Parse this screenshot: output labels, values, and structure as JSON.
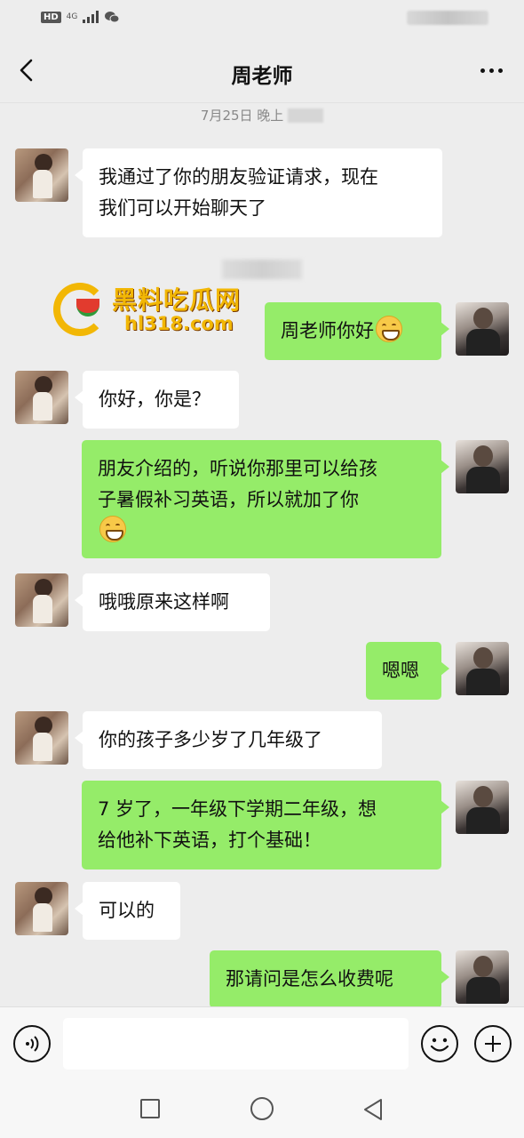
{
  "status_bar": {
    "hd": "HD",
    "network": "4G"
  },
  "header": {
    "title": "周老师",
    "back_icon": "chevron-left-icon",
    "more_icon": "more-dots-icon"
  },
  "timestamp": "7月25日 晚上",
  "watermark": {
    "title": "黑料吃瓜网",
    "subtitle": "hl318.com"
  },
  "messages": [
    {
      "side": "left",
      "text": "我通过了你的朋友验证请求，现在\n我们可以开始聊天了"
    },
    {
      "side": "right",
      "text": "周老师你好",
      "emoji": "grinning-face-emoji"
    },
    {
      "side": "left",
      "text": "你好，你是？"
    },
    {
      "side": "right",
      "text": "朋友介绍的，听说你那里可以给孩\n子暑假补习英语，所以就加了你",
      "emoji": "grinning-face-emoji"
    },
    {
      "side": "left",
      "text": "哦哦原来这样啊"
    },
    {
      "side": "right",
      "text": "嗯嗯"
    },
    {
      "side": "left",
      "text": "你的孩子多少岁了几年级了"
    },
    {
      "side": "right",
      "text": "7 岁了，一年级下学期二年级，想\n给他补下英语，打个基础！"
    },
    {
      "side": "left",
      "text": "可以的"
    },
    {
      "side": "right",
      "text": "那请问是怎么收费呢"
    }
  ],
  "input_bar": {
    "voice_icon": "voice-icon",
    "emoji_icon": "emoji-icon",
    "plus_icon": "plus-icon",
    "input_value": ""
  },
  "colors": {
    "sent_bubble": "#95ec69",
    "received_bubble": "#ffffff",
    "background": "#ededed"
  }
}
